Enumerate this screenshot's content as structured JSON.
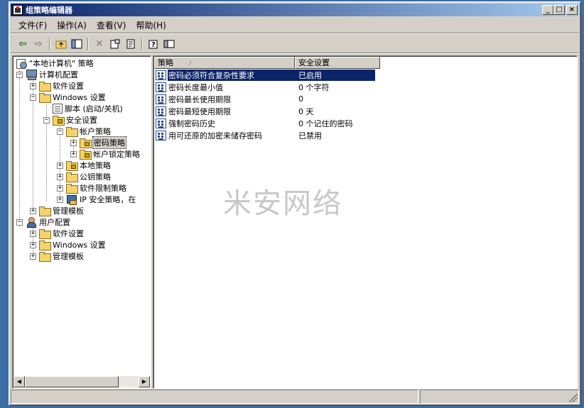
{
  "window": {
    "title": "组策略编辑器",
    "buttons": {
      "minimize": "_",
      "maximize": "□",
      "close": "×"
    }
  },
  "menu": [
    {
      "label": "文件(F)"
    },
    {
      "label": "操作(A)"
    },
    {
      "label": "查看(V)"
    },
    {
      "label": "帮助(H)"
    }
  ],
  "toolbar": {
    "icons": [
      "back-arrow-icon",
      "forward-arrow-icon",
      "up-folder-icon",
      "show-hide-tree-icon",
      "delete-icon",
      "properties-icon",
      "export-list-icon",
      "help-icon",
      "console-icon"
    ]
  },
  "tree": {
    "root": "\"本地计算机\" 策略",
    "computer_config": "计算机配置",
    "cc_software": "软件设置",
    "cc_windows": "Windows 设置",
    "scripts": "脚本 (启动/关机)",
    "security": "安全设置",
    "account_policy": "帐户策略",
    "password_policy": "密码策略",
    "lockout_policy": "帐户锁定策略",
    "local_policy": "本地策略",
    "public_key": "公钥策略",
    "software_restriction": "软件限制策略",
    "ipsec": "IP 安全策略，在",
    "cc_admin_templates": "管理模板",
    "user_config": "用户配置",
    "uc_software": "软件设置",
    "uc_windows": "Windows 设置",
    "uc_admin_templates": "管理模板"
  },
  "list": {
    "columns": [
      "策略",
      "安全设置"
    ],
    "sort_indicator": "/",
    "rows": [
      {
        "name": "密码必须符合复杂性要求",
        "value": "已启用"
      },
      {
        "name": "密码长度最小值",
        "value": "0 个字符"
      },
      {
        "name": "密码最长使用期限",
        "value": "0"
      },
      {
        "name": "密码最短使用期限",
        "value": "0 天"
      },
      {
        "name": "强制密码历史",
        "value": "0 个记住的密码"
      },
      {
        "name": "用可还原的加密来储存密码",
        "value": "已禁用"
      }
    ]
  },
  "watermark": "米安网络",
  "colors": {
    "titlebar_start": "#0a246a",
    "titlebar_end": "#a6caf0",
    "selection": "#0a246a",
    "chrome": "#d4d0c8"
  }
}
